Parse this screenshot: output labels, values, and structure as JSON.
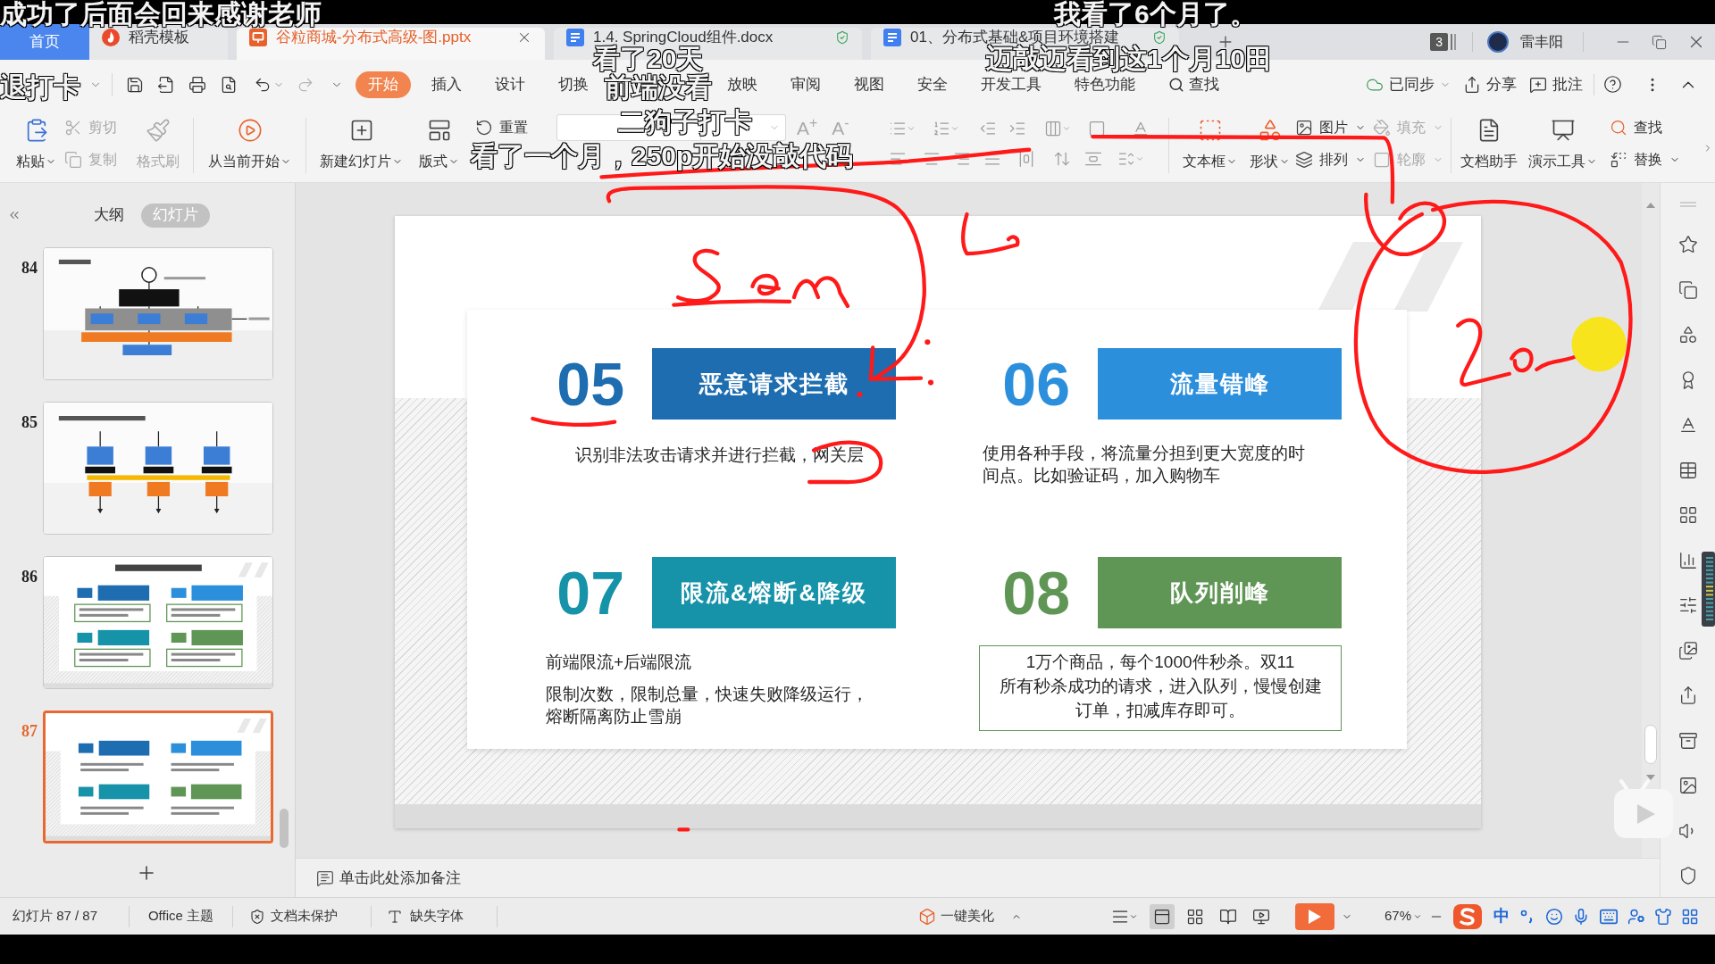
{
  "danmaku": [
    "成功了后面会回来感谢老师",
    "我看了6个月了。",
    "看了20天",
    "迈敲迈看到这1个月10田",
    "退打卡",
    "前端没看",
    "二狗子打卡",
    "看了一个月，250p开始没敲代码"
  ],
  "tabs": [
    {
      "label": "首页",
      "kind": "home",
      "selected": false
    },
    {
      "label": "稻壳模板",
      "kind": "docer",
      "selected": false
    },
    {
      "label": "谷粒商城-分布式高级-图.pptx",
      "kind": "slides",
      "selected": true
    },
    {
      "label": "1.4. SpringCloud组件.docx",
      "kind": "writer",
      "selected": false
    },
    {
      "label": "01、分布式基础&项目环境搭建",
      "kind": "writer",
      "selected": false
    }
  ],
  "account": {
    "badge": "3",
    "user": "雷丰阳"
  },
  "menu": {
    "tabs": [
      {
        "label": "开始",
        "selected": true
      },
      {
        "label": "插入",
        "selected": false
      },
      {
        "label": "设计",
        "selected": false
      },
      {
        "label": "切换",
        "selected": false
      },
      {
        "label": "放映",
        "selected": false
      },
      {
        "label": "审阅",
        "selected": false
      },
      {
        "label": "视图",
        "selected": false
      },
      {
        "label": "安全",
        "selected": false
      },
      {
        "label": "开发工具",
        "selected": false
      },
      {
        "label": "特色功能",
        "selected": false
      }
    ],
    "search": "查找",
    "actions": [
      {
        "label": "已同步",
        "kind": "sync"
      },
      {
        "label": "分享",
        "kind": "share"
      },
      {
        "label": "批注",
        "kind": "comment"
      }
    ]
  },
  "toolbar": {
    "items": [
      {
        "label": "粘贴",
        "kind": "large",
        "dropdown": true,
        "disabled": false
      },
      {
        "label": "剪切",
        "kind": "small",
        "dropdown": false,
        "disabled": true
      },
      {
        "label": "复制",
        "kind": "small",
        "dropdown": false,
        "disabled": true
      },
      {
        "label": "格式刷",
        "kind": "large",
        "dropdown": false,
        "disabled": true
      },
      {
        "label": "从当前开始",
        "kind": "large",
        "dropdown": true,
        "disabled": false
      },
      {
        "label": "新建幻灯片",
        "kind": "large",
        "dropdown": true,
        "disabled": false
      },
      {
        "label": "版式",
        "kind": "large",
        "dropdown": true,
        "disabled": false
      },
      {
        "label": "重置",
        "kind": "small",
        "dropdown": false,
        "disabled": false
      },
      {
        "label": "文本框",
        "kind": "large",
        "dropdown": true,
        "disabled": false
      },
      {
        "label": "形状",
        "kind": "large",
        "dropdown": true,
        "disabled": false
      },
      {
        "label": "图片",
        "kind": "small",
        "dropdown": true,
        "disabled": false
      },
      {
        "label": "排列",
        "kind": "small",
        "dropdown": true,
        "disabled": false
      },
      {
        "label": "填充",
        "kind": "small",
        "dropdown": true,
        "disabled": true
      },
      {
        "label": "轮廓",
        "kind": "small",
        "dropdown": true,
        "disabled": true
      },
      {
        "label": "文档助手",
        "kind": "large",
        "dropdown": false,
        "disabled": false
      },
      {
        "label": "演示工具",
        "kind": "large",
        "dropdown": true,
        "disabled": false
      },
      {
        "label": "查找",
        "kind": "small",
        "dropdown": false,
        "disabled": false
      },
      {
        "label": "替换",
        "kind": "small",
        "dropdown": true,
        "disabled": false
      }
    ],
    "size_buttons": [
      "A$^{+}$",
      "A$^{-}$"
    ]
  },
  "panel": {
    "tabs": [
      {
        "label": "大纲",
        "selected": false
      },
      {
        "label": "幻灯片",
        "selected": true
      }
    ],
    "slides": [
      {
        "number": "84",
        "kind": "flowchart",
        "selected": false
      },
      {
        "number": "85",
        "kind": "columns",
        "selected": false
      },
      {
        "number": "86",
        "kind": "titled-grid",
        "selected": false
      },
      {
        "number": "87",
        "kind": "grid",
        "selected": true
      }
    ]
  },
  "slide": {
    "items": [
      {
        "number": "05",
        "title": "恶意请求拦截",
        "color": "#1d6db0",
        "kind": "centered",
        "text": [
          "识别非法攻击请求并进行拦截，网关层"
        ]
      },
      {
        "number": "06",
        "title": "流量错峰",
        "color": "#2c8fdc",
        "kind": "plain",
        "text": [
          "使用各种手段，将流量分担到更大宽度的时间点。比如验证码，加入购物车"
        ]
      },
      {
        "number": "07",
        "title": "限流&熔断&降级",
        "color": "#1692a9",
        "kind": "plain",
        "text": [
          "前端限流+后端限流",
          "限制次数，限制总量，快速失败降级运行，熔断隔离防止雪崩"
        ]
      },
      {
        "number": "08",
        "title": "队列削峰",
        "color": "#5f9655",
        "kind": "framed",
        "text": [
          "1万个商品，每个1000件秒杀。双11",
          "所有秒杀成功的请求，进入队列，慢慢创建订单，扣减库存即可。"
        ]
      }
    ]
  },
  "notes": {
    "placeholder": "单击此处添加备注"
  },
  "status": {
    "slide": "幻灯片 87 / 87",
    "theme": "Office 主题",
    "protection": "文档未保护",
    "fonts": "缺失字体",
    "beautify": "一键美化",
    "views": [
      {
        "selected": true
      },
      {
        "selected": false
      },
      {
        "selected": false
      },
      {
        "selected": false
      }
    ],
    "zoom": "67%",
    "ime": "中"
  }
}
